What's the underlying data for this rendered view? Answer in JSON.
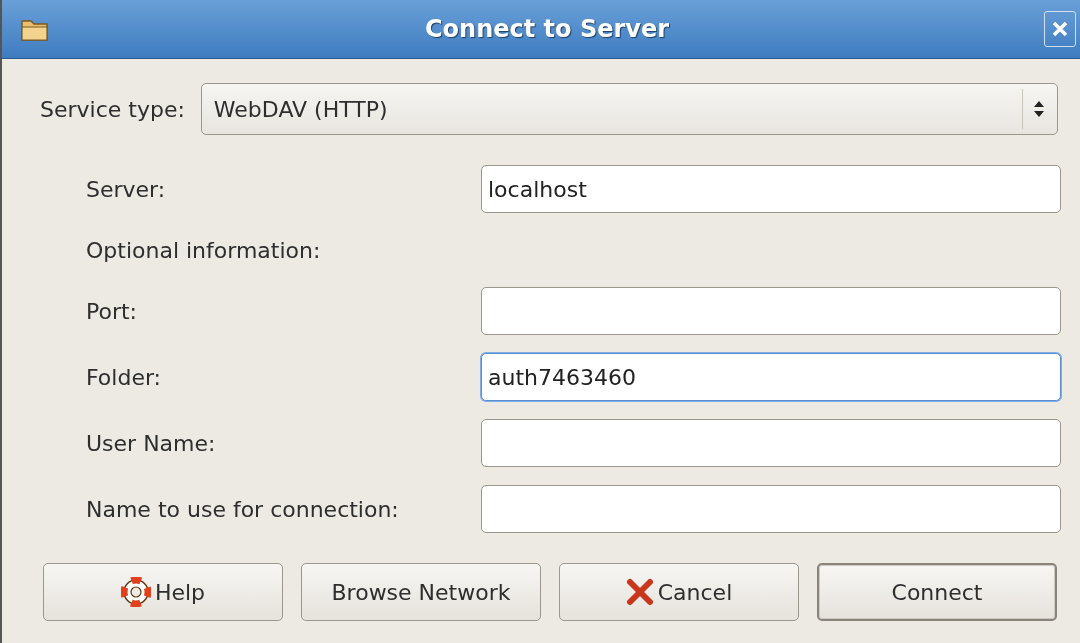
{
  "window": {
    "title": "Connect to Server"
  },
  "service_type": {
    "label": "Service type:",
    "value": "WebDAV (HTTP)"
  },
  "fields": [
    {
      "kind": "field",
      "label": "Server:",
      "value": "localhost",
      "focused": false
    },
    {
      "kind": "heading",
      "label": "Optional information:"
    },
    {
      "kind": "field",
      "label": "Port:",
      "focused": false
    },
    {
      "kind": "field",
      "label": "Folder:",
      "value": "auth7463460",
      "focused": true
    },
    {
      "kind": "field",
      "label": "User Name:",
      "focused": false
    },
    {
      "kind": "field",
      "label": "Name to use for connection:",
      "focused": false
    }
  ],
  "buttons": [
    {
      "label": "Help",
      "kind": "help",
      "default": false
    },
    {
      "label": "Browse Network",
      "kind": "plain",
      "default": false
    },
    {
      "label": "Cancel",
      "kind": "cancel",
      "default": false
    },
    {
      "label": "Connect",
      "kind": "plain",
      "default": true
    }
  ]
}
